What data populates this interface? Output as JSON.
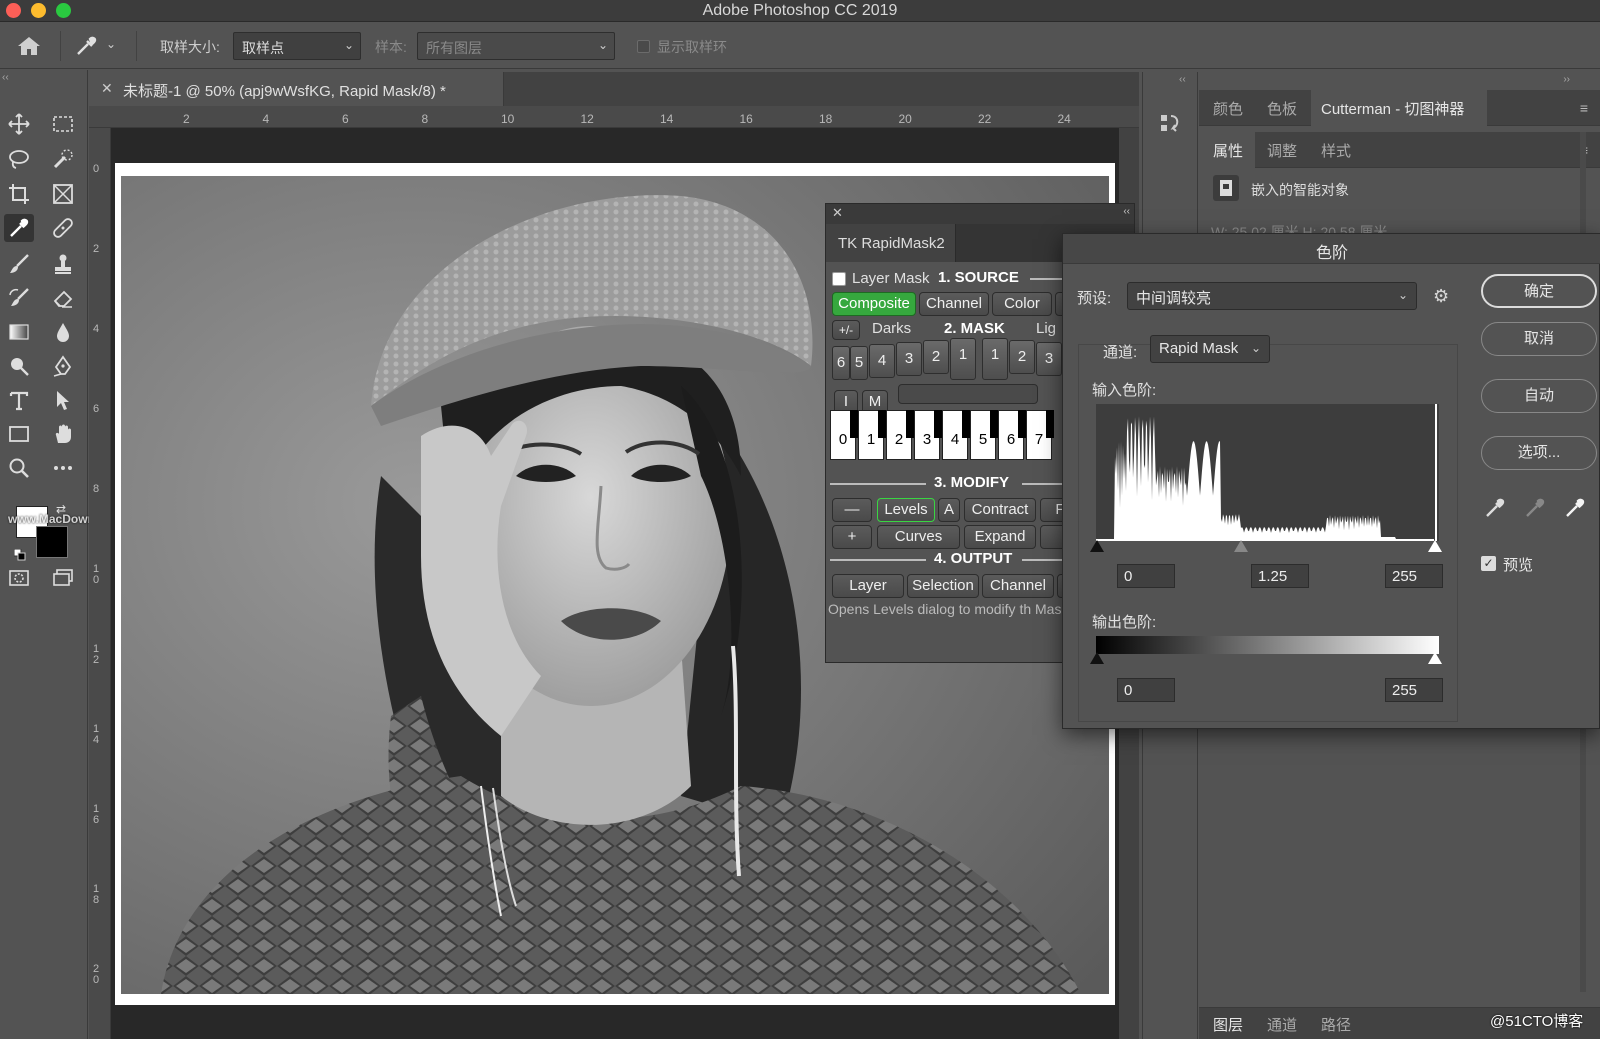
{
  "window": {
    "title": "Adobe Photoshop CC 2019"
  },
  "options_bar": {
    "sample_size_label": "取样大小:",
    "sample_size_value": "取样点",
    "sample_label": "样本:",
    "sample_value": "所有图层",
    "show_ring_label": "显示取样环"
  },
  "document": {
    "tab_title": "未标题-1 @ 50% (apj9wWsfKG, Rapid Mask/8) *",
    "ruler_h_ticks": [
      "2",
      "4",
      "6",
      "8",
      "10",
      "12",
      "14",
      "16",
      "18",
      "20",
      "22",
      "24"
    ],
    "ruler_v_ticks": [
      "0",
      "2",
      "4",
      "6",
      "8",
      "10",
      "12",
      "14",
      "16",
      "18",
      "20"
    ]
  },
  "left_watermark": "www.MacDown.com",
  "right_watermark": "@51CTO博客",
  "tools": [
    "move-icon",
    "marquee-icon",
    "lasso-icon",
    "quick-select-icon",
    "crop-icon",
    "frame-icon",
    "eyedropper-icon",
    "healing-icon",
    "brush-icon",
    "stamp-icon",
    "history-brush-icon",
    "eraser-icon",
    "gradient-icon",
    "blur-icon",
    "dodge-icon",
    "pen-icon",
    "type-icon",
    "path-select-icon",
    "rectangle-icon",
    "hand-icon",
    "zoom-icon",
    "more-icon"
  ],
  "panels": {
    "top_tabs": [
      "颜色",
      "色板",
      "Cutterman - 切图神器"
    ],
    "mid_tabs": [
      "属性",
      "调整",
      "样式"
    ],
    "smart_object_label": "嵌入的智能对象",
    "faded_dims": "W: 25.02 厘米      H: 20.58 厘米",
    "bottom_tabs": [
      "图层",
      "通道",
      "路径"
    ]
  },
  "rapidmask": {
    "tab": "TK RapidMask2",
    "layer_mask_label": "Layer Mask",
    "source_head": "1. SOURCE",
    "source_buttons": [
      "Composite",
      "Channel",
      "Color"
    ],
    "pm_label": "+/-",
    "darks_label": "Darks",
    "mask_head": "2. MASK",
    "lights_label": "Lig",
    "dark_nums": [
      "6",
      "5",
      "4",
      "3",
      "2",
      "1"
    ],
    "light_nums": [
      "1",
      "2",
      "3"
    ],
    "im_buttons": [
      "I",
      "M"
    ],
    "keys": [
      "0",
      "1",
      "2",
      "3",
      "4",
      "5",
      "6",
      "7"
    ],
    "modify_head": "3. MODIFY",
    "minus_btn": "—",
    "plus_btn": "+",
    "levels_btn": "Levels",
    "a_btn": "A",
    "contract_btn": "Contract",
    "f_btn": "F",
    "curves_btn": "Curves",
    "expand_btn": "Expand",
    "output_head": "4. OUTPUT",
    "output_buttons": [
      "Layer",
      "Selection",
      "Channel"
    ],
    "description": "Opens Levels dialog to modify th Mask.\""
  },
  "levels": {
    "title": "色阶",
    "preset_label": "预设:",
    "preset_value": "中间调较亮",
    "channel_label": "通道:",
    "channel_value": "Rapid Mask",
    "input_label": "输入色阶:",
    "input_black": "0",
    "input_gamma": "1.25",
    "input_white": "255",
    "output_label": "输出色阶:",
    "output_black": "0",
    "output_white": "255",
    "ok_btn": "确定",
    "cancel_btn": "取消",
    "auto_btn": "自动",
    "options_btn": "选项...",
    "preview_label": "预览",
    "preview_checked": true
  }
}
